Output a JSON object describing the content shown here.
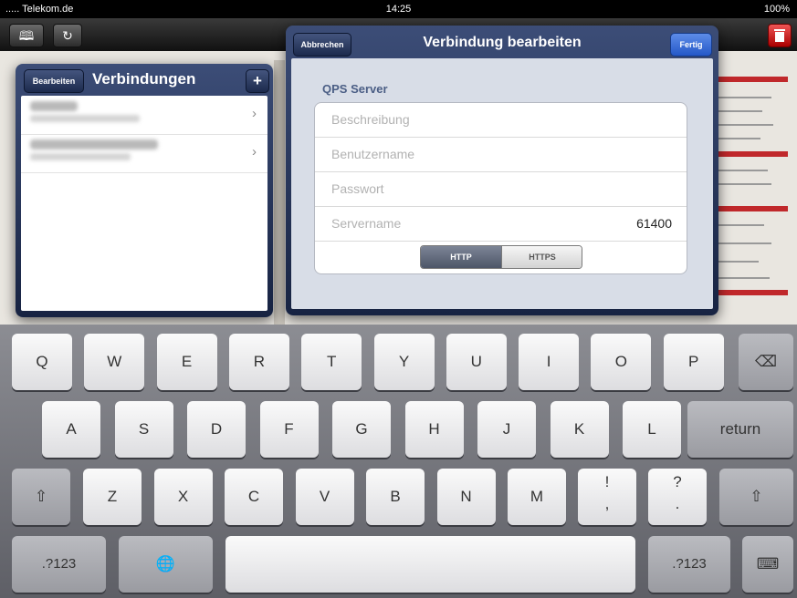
{
  "status_bar": {
    "carrier": "..... Telekom.de",
    "time": "14:25",
    "battery": "100%"
  },
  "toolbar": {
    "bookmarks_icon": "book-icon",
    "reload_icon": "reload-icon",
    "trash_icon": "trash-icon"
  },
  "connections_popover": {
    "edit_label": "Bearbeiten",
    "title": "Verbindungen",
    "add_label": "+",
    "items": [
      {
        "name": "Spiegel QS",
        "url": "http://qps-server.spiegel.de"
      },
      {
        "name": "Spiegel production",
        "url": "http://spiegel.de"
      }
    ]
  },
  "edit_popover": {
    "cancel_label": "Abbrechen",
    "title": "Verbindung bearbeiten",
    "done_label": "Fertig",
    "section_title": "QPS Server",
    "fields": [
      {
        "placeholder": "Beschreibung",
        "value": ""
      },
      {
        "placeholder": "Benutzername",
        "value": ""
      },
      {
        "placeholder": "Passwort",
        "value": ""
      },
      {
        "placeholder": "Servername",
        "value": "61400"
      }
    ],
    "protocol": {
      "options": [
        "HTTP",
        "HTTPS"
      ],
      "selected": "HTTP"
    }
  },
  "keyboard": {
    "row1": [
      "Q",
      "W",
      "E",
      "R",
      "T",
      "Y",
      "U",
      "I",
      "O",
      "P"
    ],
    "row2": [
      "A",
      "S",
      "D",
      "F",
      "G",
      "H",
      "J",
      "K",
      "L"
    ],
    "row3": [
      "Z",
      "X",
      "C",
      "V",
      "B",
      "N",
      "M"
    ],
    "return_label": "return",
    "numbers_label": ".?123",
    "excl_top": "!",
    "excl_bottom": ",",
    "quest_top": "?",
    "quest_bottom": "."
  }
}
